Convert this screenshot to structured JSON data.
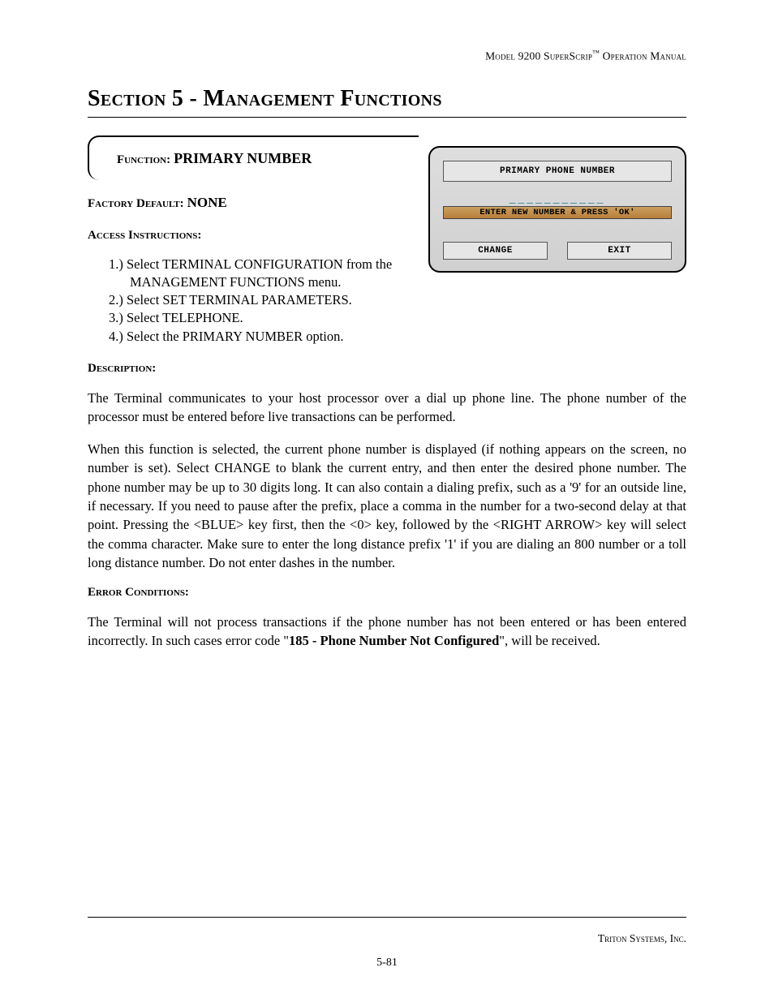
{
  "header": {
    "model": "Model 9200 SuperScrip",
    "tm": "™",
    "manual": " Operation Manual"
  },
  "section_title": "Section 5 - Management Functions",
  "function_block": {
    "label": "Function:",
    "value": "  PRIMARY NUMBER"
  },
  "factory": {
    "label": "Factory Default:",
    "value": " NONE"
  },
  "access": {
    "heading": "Access Instructions:",
    "items": [
      "1.)  Select TERMINAL CONFIGURATION from the MANAGEMENT FUNCTIONS menu.",
      "2.)  Select SET TERMINAL PARAMETERS.",
      "3.)  Select TELEPHONE.",
      "4.)  Select the PRIMARY NUMBER option."
    ]
  },
  "description": {
    "heading": "Description:",
    "p1": "The Terminal communicates to your host processor over a dial up phone line.  The phone number of the processor must be entered before live transactions can be performed.",
    "p2": "When this function is selected, the current phone number is displayed (if nothing appears on the screen, no number is set).  Select CHANGE to blank the current entry, and then enter the desired phone number.  The phone number may be up to 30 digits long.  It can also contain a dialing prefix, such as a '9' for an outside line, if necessary.  If you need to pause after the prefix, place a comma in the number for a two-second delay at that point.  Pressing the <BLUE> key first, then the <0> key, followed by the <RIGHT ARROW> key will select the comma character.  Make sure to enter the long distance prefix '1' if you are dialing an 800 number or a toll long distance number.  Do not enter dashes in the number."
  },
  "error": {
    "heading": "Error Conditions:",
    "p_before": "The Terminal will not process transactions if the phone number has not been entered or has been entered incorrectly. In such cases error code \"",
    "code": "185 - Phone Number Not Configured",
    "p_after": "\", will be received."
  },
  "terminal": {
    "title": "PRIMARY PHONE NUMBER",
    "dashes": "___________",
    "instruction": "ENTER NEW NUMBER & PRESS 'OK'",
    "btn_change": "CHANGE",
    "btn_exit": "EXIT"
  },
  "footer": {
    "company": "Triton Systems, Inc.",
    "page": "5-81"
  }
}
